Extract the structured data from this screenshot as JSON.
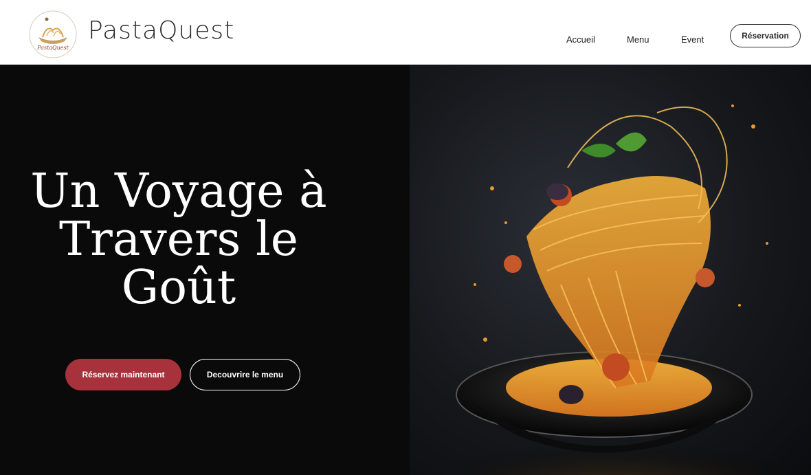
{
  "brand": {
    "name": "PastaQuest",
    "logo_text": "PastaQuest"
  },
  "nav": {
    "items": [
      "Accueil",
      "Menu",
      "Event"
    ],
    "reservation_label": "Réservation"
  },
  "hero": {
    "title_lines": [
      "Un Voyage à",
      "Travers le",
      "Goût"
    ],
    "primary_button": "Réservez maintenant",
    "secondary_button": "Decouvrire le menu"
  },
  "colors": {
    "accent": "#a8323b",
    "background": "#0a0a0a",
    "pasta": "#e89a2c"
  }
}
